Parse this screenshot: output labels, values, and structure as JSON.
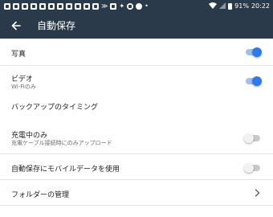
{
  "status_bar": {
    "battery": "91%",
    "time": "20:22"
  },
  "app_bar": {
    "title": "自動保存"
  },
  "settings": [
    {
      "label": "写真",
      "toggle": true
    },
    {
      "label": "ビデオ",
      "sub": "Wi-Fiのみ",
      "toggle": true
    },
    {
      "label": "バックアップのタイミング"
    },
    {
      "label": "充電中のみ",
      "sub": "充電ケーブル接続時にのみアップロード",
      "toggle": false
    },
    {
      "label": "自動保存にモバイルデータを使用",
      "toggle": false
    },
    {
      "label": "フォルダーの管理"
    }
  ],
  "colors": {
    "header_bg": "#2b3a4a",
    "toggle_on": "#2f7ae5",
    "toggle_off": "#c9c9c9"
  }
}
